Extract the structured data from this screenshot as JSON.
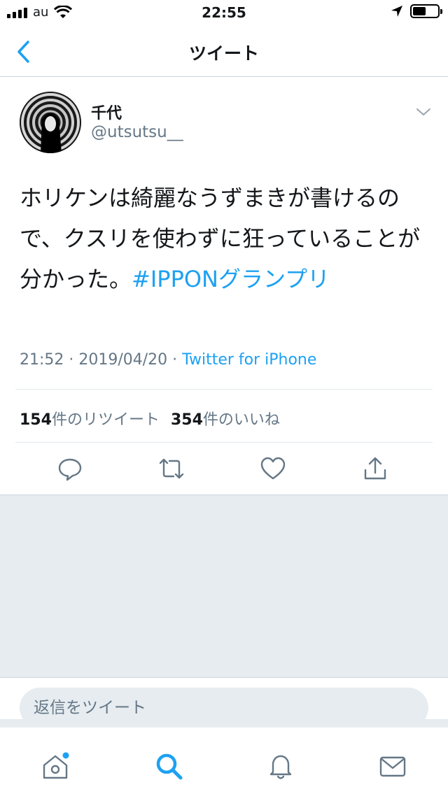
{
  "status_bar": {
    "carrier": "au",
    "time": "22:55"
  },
  "nav": {
    "title": "ツイート"
  },
  "tweet": {
    "display_name": "千代",
    "handle": "@utsutsu__",
    "text": "ホリケンは綺麗なうずまきが書けるので、クスリを使わずに狂っていることが分かった。",
    "hashtag": "#IPPONグランプリ",
    "timestamp": "21:52 · 2019/04/20 · ",
    "source": "Twitter for iPhone",
    "retweet_count": "154",
    "retweet_label": "件のリツイート",
    "like_count": "354",
    "like_label": "件のいいね"
  },
  "reply": {
    "placeholder": "返信をツイート"
  },
  "icons": {
    "back": "chevron-left-icon",
    "caret": "chevron-down-icon",
    "reply": "comment-icon",
    "retweet": "retweet-icon",
    "like": "heart-icon",
    "share": "share-icon",
    "home": "home-icon",
    "search": "search-icon",
    "notifications": "bell-icon",
    "messages": "mail-icon"
  },
  "colors": {
    "accent": "#1da1f2",
    "muted": "#657786",
    "background": "#e6ecf0"
  }
}
